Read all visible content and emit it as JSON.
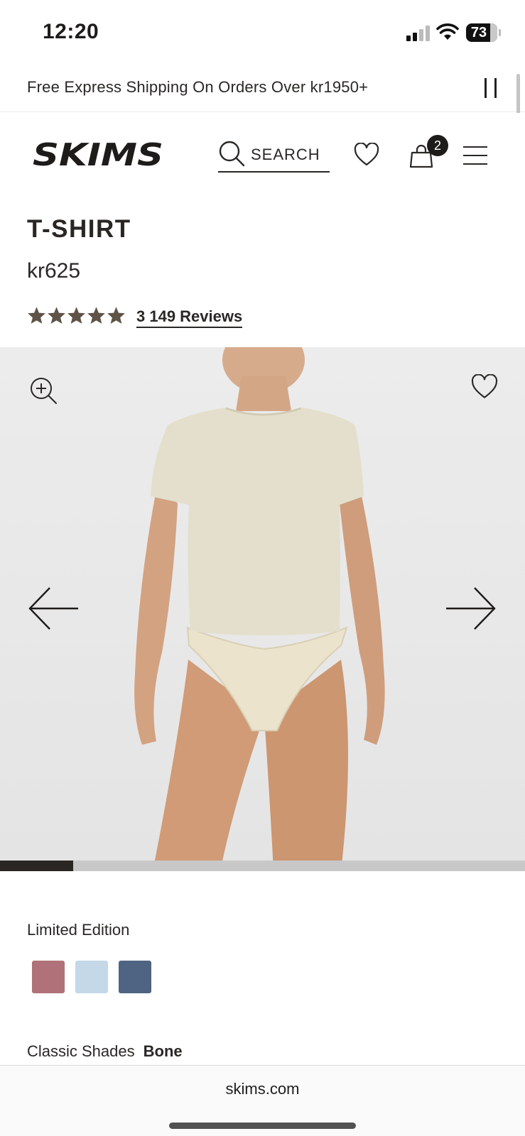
{
  "status_bar": {
    "time": "12:20",
    "battery": "73"
  },
  "promo": {
    "text": "Free Express Shipping On Orders Over kr1950+"
  },
  "header": {
    "brand": "SKIMS",
    "search_label": "SEARCH",
    "bag_count": "2"
  },
  "product": {
    "name": "T-SHIRT",
    "price": "kr625",
    "rating": 4.8,
    "rating_max": 5,
    "reviews_label": "3 149 Reviews"
  },
  "gallery": {
    "progress": 0.14
  },
  "colors": {
    "limited_label": "Limited Edition",
    "limited_swatches": [
      {
        "name": "rose",
        "color": "#b07178"
      },
      {
        "name": "blue floral",
        "color": "#c4d8e8"
      },
      {
        "name": "navy",
        "color": "#4f6482"
      }
    ],
    "classic_label": "Classic Shades",
    "classic_value": "Bone"
  },
  "browser": {
    "url": "skims.com"
  }
}
